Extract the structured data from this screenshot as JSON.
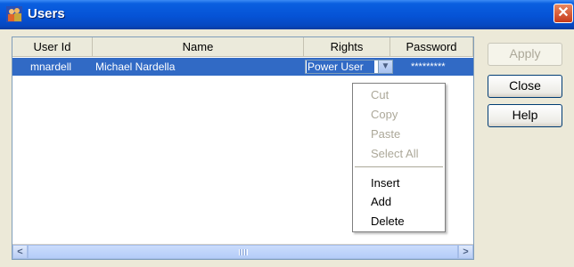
{
  "window": {
    "title": "Users"
  },
  "table": {
    "columns": [
      "User Id",
      "Name",
      "Rights",
      "Password"
    ],
    "rows": [
      {
        "user_id": "mnardell",
        "name": "Michael Nardella",
        "rights": "Power User",
        "password": "*********"
      }
    ]
  },
  "context_menu": {
    "items": [
      "Cut",
      "Copy",
      "Paste",
      "Select All",
      "Insert",
      "Add",
      "Delete"
    ]
  },
  "buttons": {
    "apply": "Apply",
    "close": "Close",
    "help": "Help"
  },
  "colors": {
    "titlebar": "#0553d6",
    "selection": "#316ac5",
    "close_button": "#c63a1b"
  }
}
